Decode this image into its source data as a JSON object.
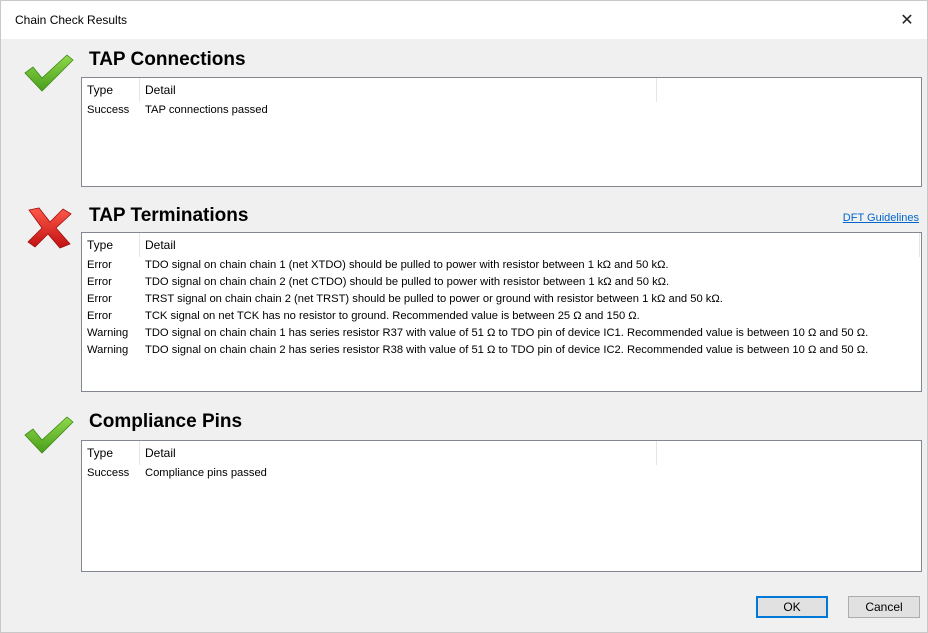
{
  "window": {
    "title": "Chain Check Results",
    "close_glyph": "✕"
  },
  "columns": {
    "type": "Type",
    "detail": "Detail"
  },
  "sections": [
    {
      "title": "TAP Connections",
      "status": "success",
      "icon": "checkmark-icon",
      "rows": [
        {
          "type": "Success",
          "detail": "TAP connections passed"
        }
      ]
    },
    {
      "title": "TAP Terminations",
      "status": "error",
      "icon": "error-x-icon",
      "link": "DFT Guidelines",
      "rows": [
        {
          "type": "Error",
          "detail": "TDO signal on chain chain 1 (net XTDO) should be pulled to power with resistor between 1 kΩ and 50 kΩ."
        },
        {
          "type": "Error",
          "detail": "TDO signal on chain chain 2 (net CTDO) should be pulled to power with resistor between 1 kΩ and 50 kΩ."
        },
        {
          "type": "Error",
          "detail": "TRST signal on chain chain 2 (net TRST) should be pulled to power or ground with resistor between 1 kΩ and 50 kΩ."
        },
        {
          "type": "Error",
          "detail": "TCK signal on net TCK has no resistor to ground. Recommended value is between 25 Ω and 150 Ω."
        },
        {
          "type": "Warning",
          "detail": "TDO signal on chain chain 1 has series resistor R37 with value of 51 Ω to TDO pin of device IC1. Recommended value is between 10 Ω and 50 Ω."
        },
        {
          "type": "Warning",
          "detail": "TDO signal on chain chain 2 has series resistor R38 with value of 51 Ω to TDO pin of device IC2. Recommended value is between 10 Ω and 50 Ω."
        }
      ]
    },
    {
      "title": "Compliance Pins",
      "status": "success",
      "icon": "checkmark-icon",
      "rows": [
        {
          "type": "Success",
          "detail": "Compliance pins passed"
        }
      ]
    }
  ],
  "buttons": {
    "ok": "OK",
    "cancel": "Cancel"
  },
  "colors": {
    "check_green": "#6dbf2e",
    "error_red": "#e02020",
    "link_blue": "#0066cc",
    "accent": "#0078d7"
  }
}
